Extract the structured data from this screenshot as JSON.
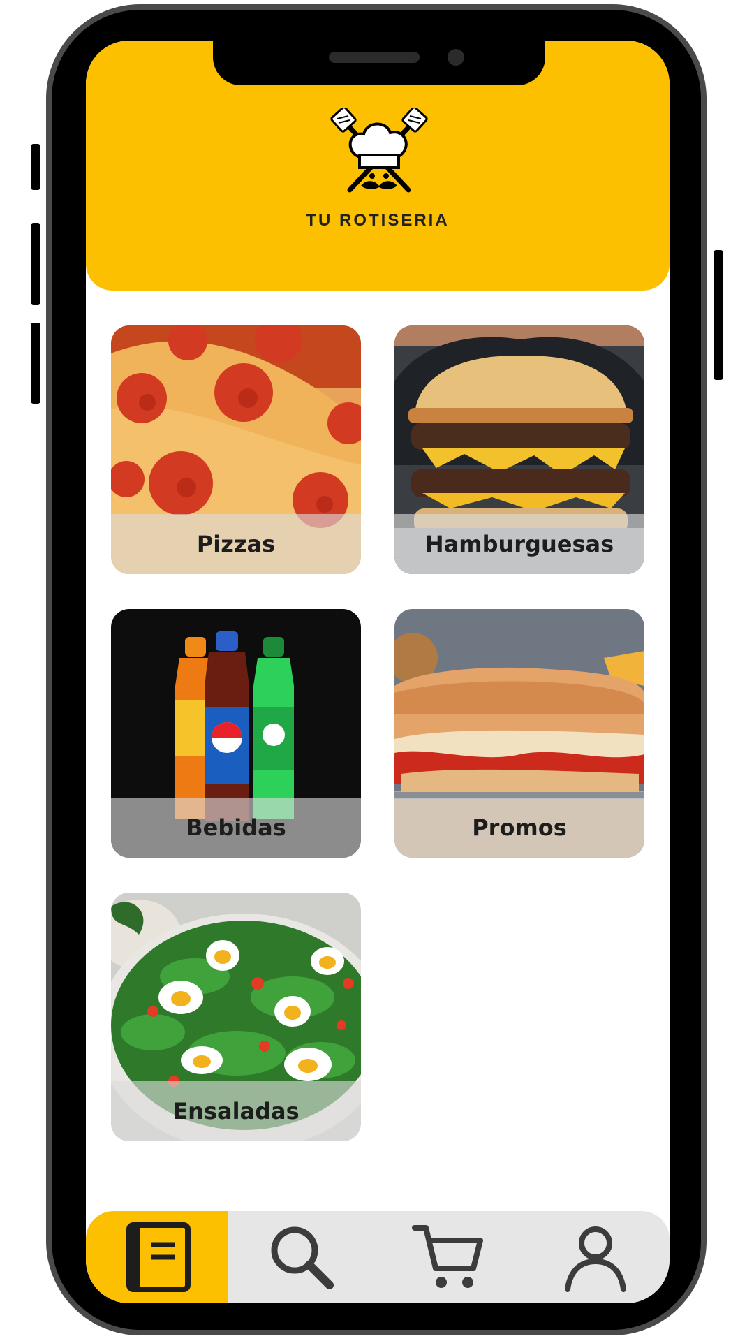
{
  "app": {
    "brand_name": "TU ROTISERIA",
    "logo_icon": "chef-hat-crossed-utensils-logo"
  },
  "colors": {
    "accent": "#fdc000",
    "nav_background": "#e6e6e6",
    "label_overlay": "rgba(220,220,220,0.62)"
  },
  "categories": [
    {
      "label": "Pizzas",
      "image": "pepperoni-pizza-photo"
    },
    {
      "label": "Hamburguesas",
      "image": "double-cheeseburger-photo"
    },
    {
      "label": "Bebidas",
      "image": "soda-bottles-photo"
    },
    {
      "label": "Promos",
      "image": "sandwich-promo-photo"
    },
    {
      "label": "Ensaladas",
      "image": "egg-salad-photo"
    }
  ],
  "bottom_nav": [
    {
      "icon": "menu-book-icon",
      "active": true
    },
    {
      "icon": "search-icon",
      "active": false
    },
    {
      "icon": "cart-icon",
      "active": false
    },
    {
      "icon": "user-icon",
      "active": false
    }
  ]
}
